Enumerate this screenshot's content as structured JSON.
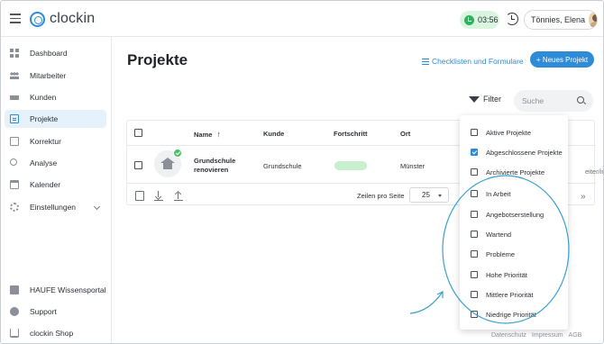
{
  "app": {
    "name": "clockin"
  },
  "topbar": {
    "timer": "03:56",
    "user_name": "Tönnies, Elena"
  },
  "sidebar": {
    "items": [
      {
        "label": "Dashboard"
      },
      {
        "label": "Mitarbeiter"
      },
      {
        "label": "Kunden"
      },
      {
        "label": "Projekte",
        "active": true
      },
      {
        "label": "Korrektur"
      },
      {
        "label": "Analyse"
      },
      {
        "label": "Kalender"
      },
      {
        "label": "Einstellungen"
      }
    ],
    "bottom_items": [
      {
        "label": "HAUFE Wissensportal"
      },
      {
        "label": "Support"
      },
      {
        "label": "clockin Shop"
      }
    ]
  },
  "main": {
    "title": "Projekte",
    "checklist_link": "Checklisten und Formulare",
    "new_project_button": "+ Neues Projekt",
    "filter_label": "Filter",
    "search_placeholder": "Suche"
  },
  "table": {
    "columns": [
      "Name",
      "Kunde",
      "Fortschritt",
      "Ort"
    ],
    "sort_indicator": "↑",
    "rows": [
      {
        "name": "Grundschule renovieren",
        "customer": "Grundschule",
        "progress": 1.0,
        "location": "Münster",
        "cutoff": "eiter/in"
      }
    ],
    "rows_per_page_label": "Zeilen pro Seite",
    "rows_per_page_value": "25",
    "next_icon": "»"
  },
  "filter_dropdown": {
    "options": [
      {
        "label": "Aktive Projekte",
        "checked": false
      },
      {
        "label": "Abgeschlossene Projekte",
        "checked": true
      },
      {
        "label": "Archivierte Projekte",
        "checked": false
      },
      {
        "label": "In Arbeit",
        "checked": false
      },
      {
        "label": "Angebotserstellung",
        "checked": false
      },
      {
        "label": "Wartend",
        "checked": false
      },
      {
        "label": "Probleme",
        "checked": false
      },
      {
        "label": "Hohe Priorität",
        "checked": false
      },
      {
        "label": "Mittlere Priorität",
        "checked": false
      },
      {
        "label": "Niedrige Priorität",
        "checked": false
      }
    ]
  },
  "footer": {
    "links": [
      "Datenschutz",
      "Impressum",
      "AGB"
    ]
  },
  "colors": {
    "accent": "#2e8bd8",
    "success": "#2fb35a",
    "progress": "#c8f0cf"
  }
}
